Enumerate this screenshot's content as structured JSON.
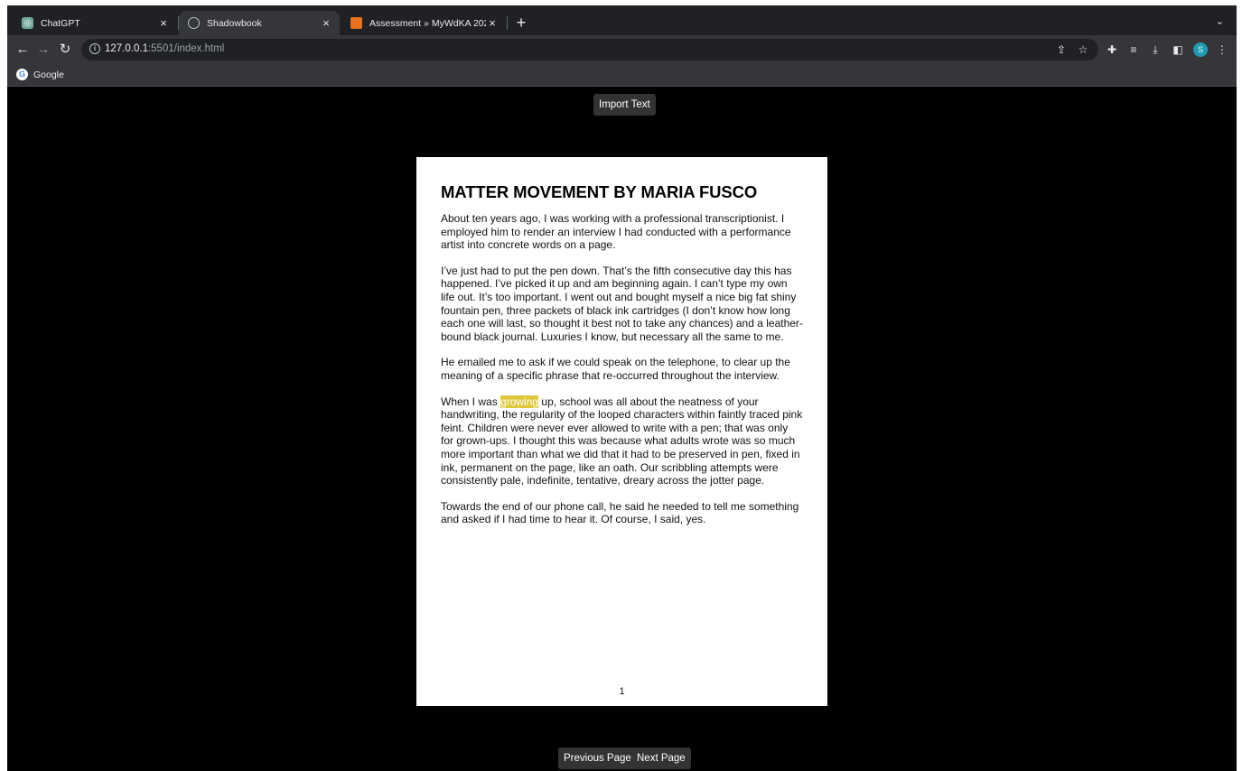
{
  "browser": {
    "tabs": [
      {
        "title": "ChatGPT",
        "favicon": "chatgpt-icon",
        "active": false
      },
      {
        "title": "Shadowbook",
        "favicon": "globe-icon",
        "active": true
      },
      {
        "title": "Assessment » MyWdKA 2023",
        "favicon": "mywdka-icon",
        "active": false
      }
    ],
    "url_host": "127.0.0.1",
    "url_rest": ":5501/index.html",
    "bookmark": "Google",
    "profile_initial": "S"
  },
  "app": {
    "import_label": "Import Text",
    "prev_label": "Previous Page",
    "next_label": "Next Page",
    "title": "MATTER MOVEMENT BY MARIA FUSCO",
    "paragraphs": [
      "About ten years ago, I was working with a professional transcriptionist. I employed him to render an interview I had conducted with a performance artist into concrete words on a page.",
      "I’ve just had to put the pen down. That’s the fifth consecutive day this has happened. I’ve picked it up and am beginning again. I can’t type my own life out. It’s too important. I went out and bought myself a nice big fat shiny fountain pen, three packets of black ink cartridges (I don’t know how long each one will last, so thought it best not to take any chances) and a leather-bound black journal. Luxuries I know, but necessary all the same to me.",
      "He emailed me to ask if we could speak on the telephone, to clear up the meaning of a specific phrase that re-occurred throughout the interview.",
      "",
      "Towards the end of our phone call, he said he needed to tell me something and asked if I had time to hear it. Of course, I said, yes."
    ],
    "para4_before": "When I was ",
    "para4_highlight": "growing",
    "para4_after": " up, school was all about the neatness of your handwriting, the regularity of the looped characters within faintly traced pink feint. Children were never ever allowed to write with a pen; that was only for grown-ups. I thought this was because what adults wrote was so much more important than what we did that it had to be preserved in pen, fixed in ink, permanent on the page, like an oath. Our scribbling attempts were consistently pale, indefinite, tentative, dreary across the jotter page.",
    "page_number": "1",
    "highlight_color": "#dfc83a"
  }
}
